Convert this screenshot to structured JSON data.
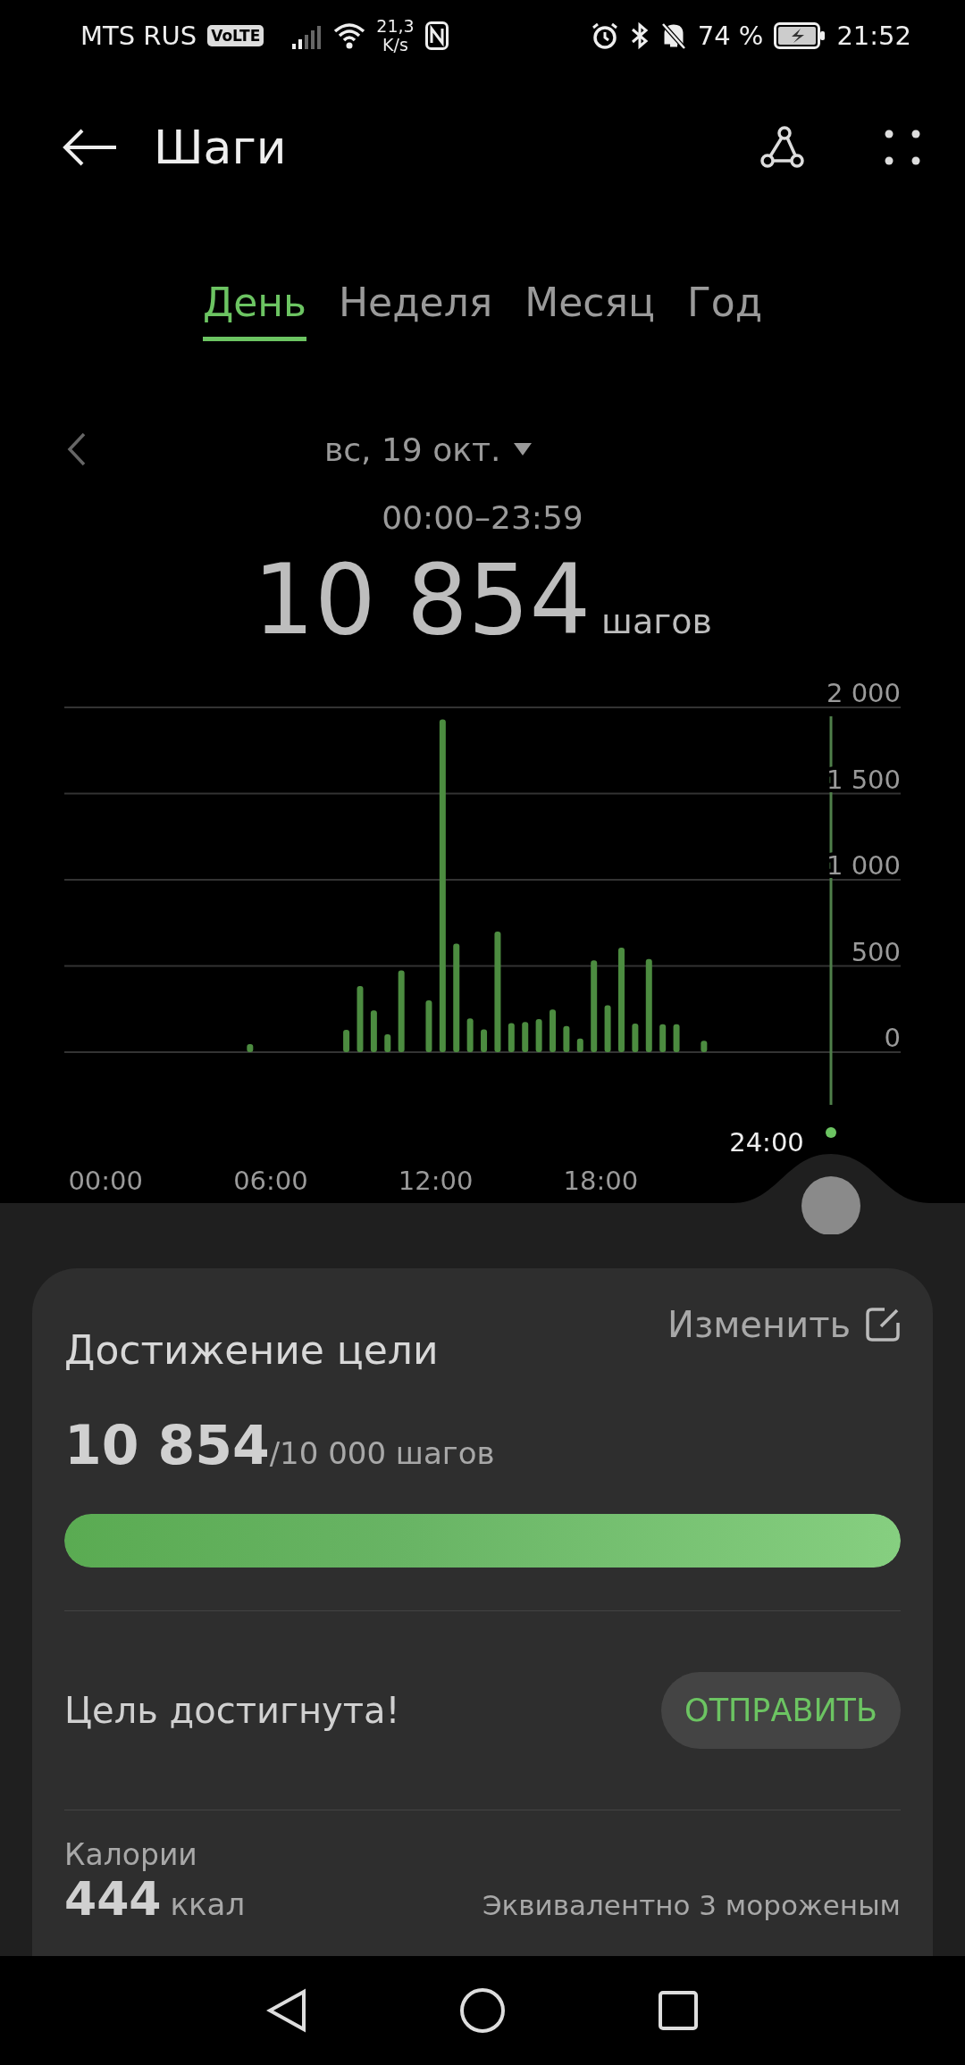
{
  "status_bar": {
    "carrier": "MTS RUS",
    "volte_badge": "VoLTE",
    "net_speed_value": "21,3",
    "net_speed_unit": "K/s",
    "battery": "74 %",
    "time": "21:52"
  },
  "header": {
    "title": "Шаги"
  },
  "tabs": [
    {
      "label": "День",
      "selected": true
    },
    {
      "label": "Неделя",
      "selected": false
    },
    {
      "label": "Месяц",
      "selected": false
    },
    {
      "label": "Год",
      "selected": false
    }
  ],
  "date_picker": {
    "date": "вс, 19 окт.",
    "time_range": "00:00–23:59"
  },
  "summary": {
    "steps": "10 854",
    "unit": "шагов"
  },
  "chart": {
    "cursor_label": "24:00",
    "chart_data": {
      "type": "bar",
      "x": [
        5.25,
        8.75,
        9.25,
        9.75,
        10.25,
        10.75,
        11.75,
        12.25,
        12.75,
        13.25,
        13.75,
        14.25,
        14.75,
        15.25,
        15.75,
        16.25,
        16.75,
        17.25,
        17.75,
        18.25,
        18.75,
        19.25,
        19.75,
        20.25,
        20.75,
        21.75
      ],
      "series": [
        {
          "color": "#4c8c40",
          "values": [
            46,
            129,
            384,
            242,
            103,
            474,
            301,
            1930,
            629,
            195,
            132,
            699,
            169,
            175,
            192,
            248,
            152,
            79,
            533,
            272,
            606,
            166,
            540,
            162,
            162,
            66
          ]
        }
      ],
      "xlim": [
        -1.5,
        28.9
      ],
      "ylim": [
        0,
        2000
      ],
      "grid": true,
      "yticks": [
        {
          "value": 0,
          "label": "0"
        },
        {
          "value": 500,
          "label": "500"
        },
        {
          "value": 1000,
          "label": "1 000"
        },
        {
          "value": 1500,
          "label": "1 500"
        },
        {
          "value": 2000,
          "label": "2 000"
        }
      ],
      "xticks": [
        {
          "value": 0,
          "label": "00:00"
        },
        {
          "value": 6,
          "label": "06:00"
        },
        {
          "value": 12,
          "label": "12:00"
        },
        {
          "value": 18,
          "label": "18:00"
        }
      ]
    }
  },
  "goal_card": {
    "title": "Достижение цели",
    "edit_label": "Изменить",
    "steps": "10 854",
    "goal": "/10 000 шагов",
    "level": 1,
    "status": "Цель достигнута!",
    "share_button": "ОТПРАВИТЬ",
    "calories_label": "Калории",
    "calories_value": "444",
    "calories_unit": "ккал",
    "equivalent": "Эквивалентно 3 мороженым"
  }
}
